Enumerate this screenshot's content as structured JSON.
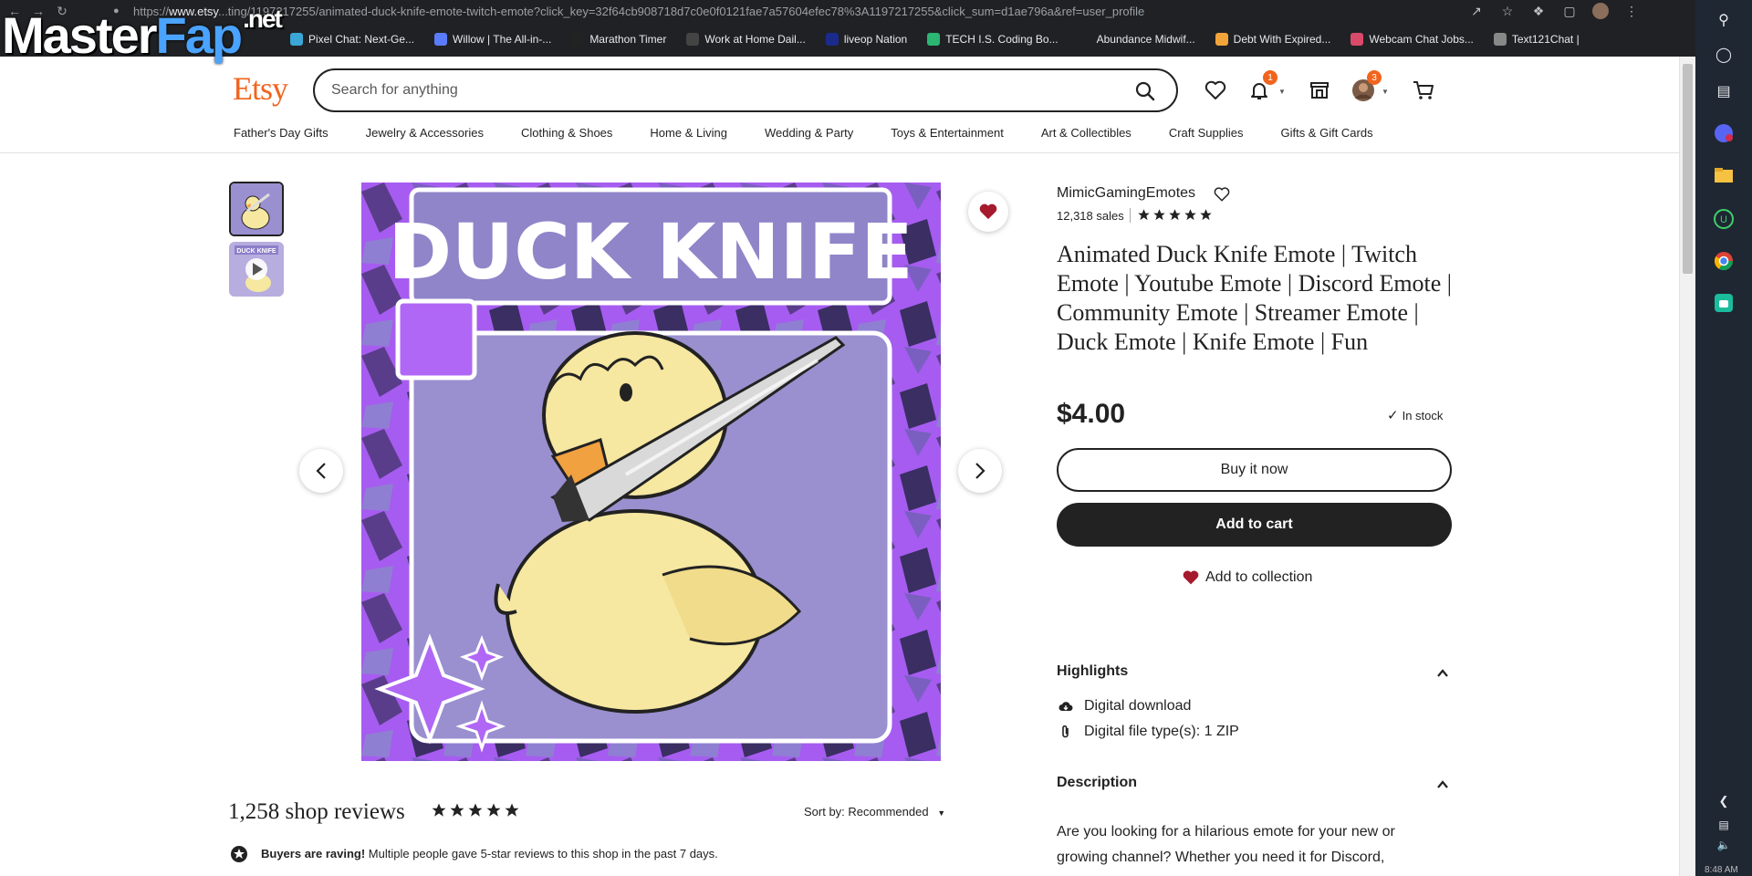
{
  "browser": {
    "url_prefix": "https://",
    "url_domain": "www.etsy",
    "url_rest": "...ting/1197217255/animated-duck-knife-emote-twitch-emote?click_key=32f64cb908718d7c0e0f0121fae7a57604efec78%3A1197217255&click_sum=d1ae796a&ref=user_profile",
    "bookmarks": [
      {
        "label": "Pixel Chat: Next-Ge...",
        "color": "#3aa7d6"
      },
      {
        "label": "Willow | The All-in-...",
        "color": "#5b7cfa"
      },
      {
        "label": "Marathon Timer",
        "color": "#222222"
      },
      {
        "label": "Work at Home Dail...",
        "color": "#444444"
      },
      {
        "label": "liveop Nation",
        "color": "#1a2b8c"
      },
      {
        "label": "TECH I.S. Coding Bo...",
        "color": "#2bb673"
      },
      {
        "label": "Abundance Midwif...",
        "color": "#202124"
      },
      {
        "label": "Debt With Expired...",
        "color": "#f2a33a"
      },
      {
        "label": "Webcam Chat Jobs...",
        "color": "#d94a6a"
      },
      {
        "label": "Text121Chat |",
        "color": "#888888"
      }
    ],
    "time": "8:48 AM"
  },
  "watermark": {
    "part1": "Master",
    "part2": "Fap",
    "part3": ".net"
  },
  "header": {
    "logo": "Etsy",
    "search_placeholder": "Search for anything",
    "notifications_count": "1",
    "account_count": "3",
    "categories": [
      "Father's Day Gifts",
      "Jewelry & Accessories",
      "Clothing & Shoes",
      "Home & Living",
      "Wedding & Party",
      "Toys & Entertainment",
      "Art & Collectibles",
      "Craft Supplies",
      "Gifts & Gift Cards"
    ]
  },
  "gallery": {
    "image_text": "DUCK KNIFE",
    "thumb2_text": "DUCK KNIFE"
  },
  "listing": {
    "shop_name": "MimicGamingEmotes",
    "sales": "12,318 sales",
    "shop_rating": 5,
    "title": "Animated Duck Knife Emote | Twitch Emote | Youtube Emote | Discord Emote | Community Emote | Streamer Emote | Duck Emote | Knife Emote | Fun",
    "price": "$4.00",
    "stock": "In stock",
    "buy_now": "Buy it now",
    "add_to_cart": "Add to cart",
    "add_to_collection": "Add to collection",
    "highlights_title": "Highlights",
    "highlights": [
      "Digital download",
      "Digital file type(s): 1 ZIP"
    ],
    "description_title": "Description",
    "description": "Are you looking for a hilarious emote for your new or growing channel? Whether you need it for Discord,"
  },
  "reviews": {
    "title": "1,258 shop reviews",
    "rating": 5,
    "sort_label": "Sort by: Recommended",
    "raving_bold": "Buyers are raving!",
    "raving_text": " Multiple people gave 5-star reviews to this shop in the past 7 days."
  },
  "colors": {
    "accent": "#f1641e",
    "heart": "#a61a2e",
    "purple": "#9a8fcf"
  }
}
